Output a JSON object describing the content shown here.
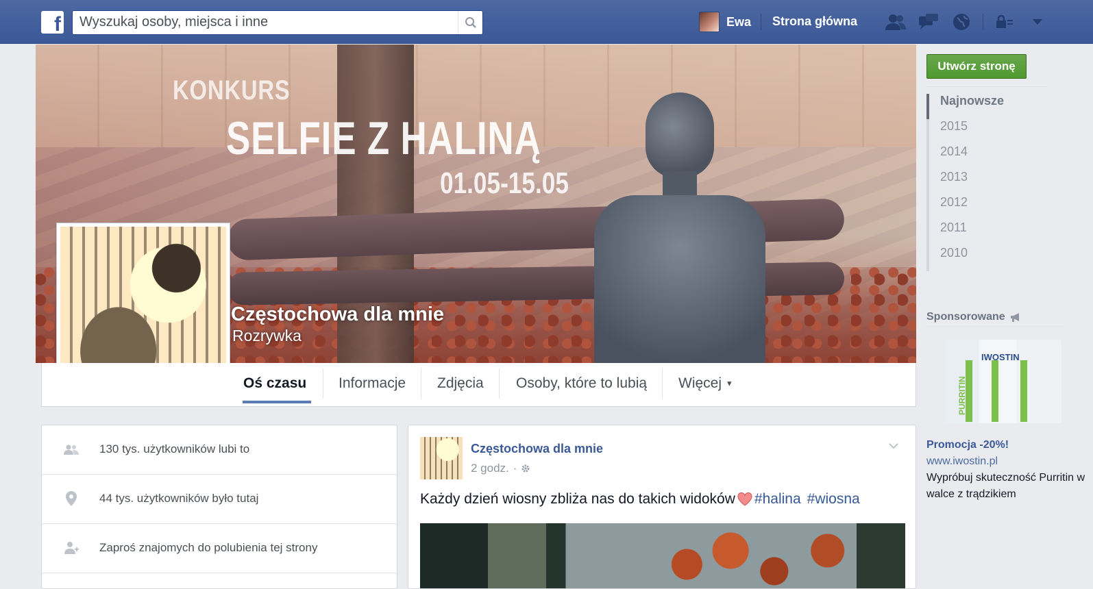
{
  "topbar": {
    "logo": "f",
    "search_placeholder": "Wyszukaj osoby, miejsca i inne",
    "user_name": "Ewa",
    "home_label": "Strona główna",
    "icons": [
      "friend-requests-icon",
      "messages-icon",
      "notifications-globe-icon",
      "privacy-lock-icon",
      "account-dropdown-icon"
    ]
  },
  "cover": {
    "kicker": "KONKURS",
    "title": "SELFIE Z HALINĄ",
    "dates": "01.05-15.05",
    "page_name": "Częstochowa dla mnie",
    "page_category": "Rozrywka"
  },
  "tabs": [
    {
      "label": "Oś czasu",
      "active": true
    },
    {
      "label": "Informacje"
    },
    {
      "label": "Zdjęcia"
    },
    {
      "label": "Osoby, które to lubią"
    },
    {
      "label": "Więcej"
    }
  ],
  "right_column": {
    "create_page_button": "Utwórz stronę",
    "years": [
      "Najnowsze",
      "2015",
      "2014",
      "2013",
      "2012",
      "2011",
      "2010"
    ],
    "sponsored_label": "Sponsorowane",
    "ad": {
      "brand": "IWOSTIN",
      "product": "PURRITIN",
      "title": "Promocja -20%!",
      "url": "www.iwostin.pl",
      "text": "Wypróbuj skuteczność Purritin w walce z trądzikiem"
    }
  },
  "info": {
    "likes": "130 tys. użytkowników lubi to",
    "checkins": "44 tys. użytkowników było tutaj",
    "invite": "Zaproś znajomych do polubienia tej strony"
  },
  "post": {
    "author": "Częstochowa dla mnie",
    "time": "2 godz.",
    "separator": "·",
    "text": "Każdy dzień wiosny zbliża nas do takich widoków",
    "hashtag1": "#halina",
    "hashtag2": "#wiosna"
  },
  "colors": {
    "brand_blue": "#3b5998",
    "cta_green": "#4e9a2f",
    "link_blue": "#365899"
  }
}
